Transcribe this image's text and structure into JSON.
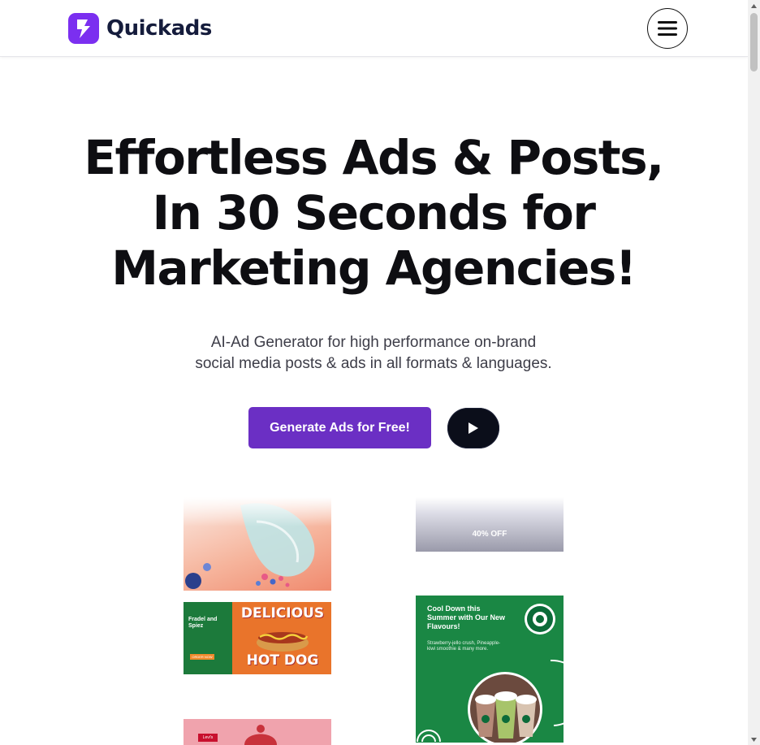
{
  "header": {
    "logo_text": "Quickads",
    "menu_icon": "hamburger-icon",
    "brand_color": "#7b2ff0"
  },
  "hero": {
    "headline_lines": [
      "Effortless Ads & Posts,",
      "In 30 Seconds for",
      "Marketing Agencies!"
    ],
    "subtitle_lines": [
      "AI-Ad Generator for high performance on-brand",
      "social media posts & ads in all formats & languages."
    ],
    "cta_label": "Generate Ads for Free!",
    "cta_color": "#6b2fc4",
    "play_icon": "play-icon"
  },
  "gallery": {
    "sale_text": "40% OFF",
    "hotdog": {
      "brand": "Fradel and Spiez",
      "title": "DELICIOUS",
      "subtitle": "HOT DOG",
      "button": "ORDER NOW"
    },
    "starbucks": {
      "headline": "Cool Down this Summer with Our New Flavours!",
      "body": "Strawberry-jello crush, Pineapple-kiwi smoothie & many more.",
      "logo": "STARBUCKS COFFEE"
    },
    "levis_badge": "Levi's"
  }
}
